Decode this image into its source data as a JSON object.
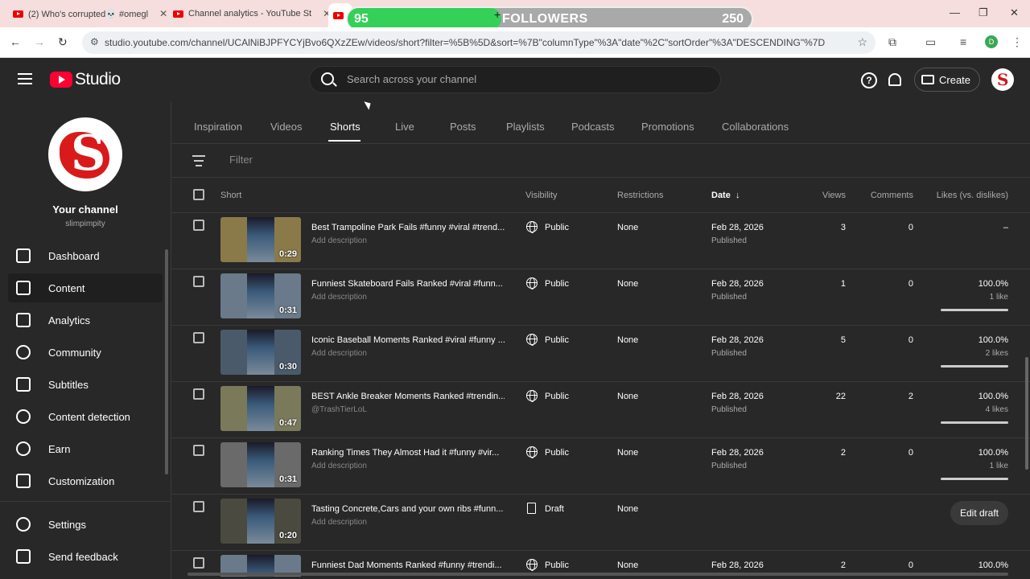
{
  "browser": {
    "tabs": [
      {
        "label": "(2) Who's corrupted💀 #omegl"
      },
      {
        "label": "Channel analytics - YouTube St"
      }
    ],
    "url": "studio.youtube.com/channel/UCAlNiBJPFYCYjBvo6QXzZEw/videos/short?filter=%5B%5D&sort=%7B\"columnType\"%3A\"date\"%2C\"sortOrder\"%3A\"DESCENDING\"%7D",
    "profile_letter": "D"
  },
  "followers_widget": {
    "current": "95",
    "label": "FOLLOWERS",
    "goal": "250",
    "progress": 0.38
  },
  "header": {
    "logo_text": "Studio",
    "search_placeholder": "Search across your channel",
    "create_label": "Create"
  },
  "channel": {
    "title": "Your channel",
    "handle": "slimpimpity"
  },
  "sidebar": {
    "items": [
      {
        "label": "Dashboard",
        "icon": "dashboard-icon"
      },
      {
        "label": "Content",
        "icon": "content-icon"
      },
      {
        "label": "Analytics",
        "icon": "analytics-icon"
      },
      {
        "label": "Community",
        "icon": "community-icon"
      },
      {
        "label": "Subtitles",
        "icon": "subtitles-icon"
      },
      {
        "label": "Content detection",
        "icon": "copyright-icon"
      },
      {
        "label": "Earn",
        "icon": "dollar-icon"
      },
      {
        "label": "Customization",
        "icon": "magic-wand-icon"
      }
    ],
    "bottom": [
      {
        "label": "Settings",
        "icon": "gear-icon"
      },
      {
        "label": "Send feedback",
        "icon": "feedback-icon"
      }
    ]
  },
  "content_tabs": [
    "Inspiration",
    "Videos",
    "Shorts",
    "Live",
    "Posts",
    "Playlists",
    "Podcasts",
    "Promotions",
    "Collaborations"
  ],
  "filter_placeholder": "Filter",
  "table": {
    "columns": {
      "short": "Short",
      "visibility": "Visibility",
      "restrictions": "Restrictions",
      "date": "Date",
      "views": "Views",
      "comments": "Comments",
      "likes": "Likes (vs. dislikes)"
    },
    "rows": [
      {
        "title": "Best Trampoline Park Fails #funny #viral #trend...",
        "desc": "Add description",
        "duration": "0:29",
        "visibility": "Public",
        "restrictions": "None",
        "date": "Feb 28, 2026",
        "status": "Published",
        "views": "3",
        "comments": "0",
        "likes": "–",
        "like_count": "",
        "like_ratio": null
      },
      {
        "title": "Funniest Skateboard Fails Ranked #viral #funn...",
        "desc": "Add description",
        "duration": "0:31",
        "visibility": "Public",
        "restrictions": "None",
        "date": "Feb 28, 2026",
        "status": "Published",
        "views": "1",
        "comments": "0",
        "likes": "100.0%",
        "like_count": "1 like",
        "like_ratio": 1.0
      },
      {
        "title": "Iconic Baseball Moments Ranked #viral #funny ...",
        "desc": "Add description",
        "duration": "0:30",
        "visibility": "Public",
        "restrictions": "None",
        "date": "Feb 28, 2026",
        "status": "Published",
        "views": "5",
        "comments": "0",
        "likes": "100.0%",
        "like_count": "2 likes",
        "like_ratio": 1.0
      },
      {
        "title": "BEST Ankle Breaker Moments Ranked #trendin...",
        "desc": "@TrashTierLoL",
        "duration": "0:47",
        "visibility": "Public",
        "restrictions": "None",
        "date": "Feb 28, 2026",
        "status": "Published",
        "views": "22",
        "comments": "2",
        "likes": "100.0%",
        "like_count": "4 likes",
        "like_ratio": 1.0
      },
      {
        "title": "Ranking Times They Almost Had it #funny #vir...",
        "desc": "Add description",
        "duration": "0:31",
        "visibility": "Public",
        "restrictions": "None",
        "date": "Feb 28, 2026",
        "status": "Published",
        "views": "2",
        "comments": "0",
        "likes": "100.0%",
        "like_count": "1 like",
        "like_ratio": 1.0
      },
      {
        "title": "Tasting Concrete,Cars and your own ribs #funn...",
        "desc": "Add description",
        "duration": "0:20",
        "visibility": "Draft",
        "restrictions": "None",
        "date": "",
        "status": "",
        "views": "",
        "comments": "",
        "likes": "",
        "like_count": "",
        "like_ratio": null,
        "draft_action": "Edit draft"
      },
      {
        "title": "Funniest Dad Moments Ranked #funny #trendi...",
        "desc": "",
        "duration": "",
        "visibility": "Public",
        "restrictions": "None",
        "date": "Feb 28, 2026",
        "status": "",
        "views": "2",
        "comments": "0",
        "likes": "100.0%",
        "like_count": "",
        "like_ratio": null
      }
    ]
  }
}
